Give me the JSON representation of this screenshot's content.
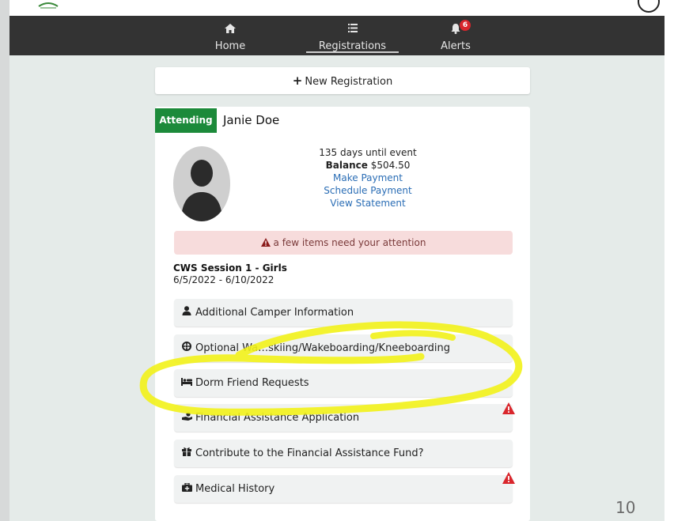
{
  "nav": {
    "items": [
      {
        "label": "Home",
        "icon": "home-icon"
      },
      {
        "label": "Registrations",
        "icon": "list-icon",
        "active": true
      },
      {
        "label": "Alerts",
        "icon": "bell-icon",
        "badge": "6"
      }
    ]
  },
  "new_registration": {
    "label": "New Registration"
  },
  "registration": {
    "status": "Attending",
    "camper_name": "Janie Doe",
    "days_until": "135 days until event",
    "balance_label": "Balance",
    "balance_value": "$504.50",
    "links": [
      "Make Payment",
      "Schedule Payment",
      "View Statement"
    ],
    "attention": "a few items need your attention",
    "session_title": "CWS Session 1 - Girls",
    "session_dates": "6/5/2022 - 6/10/2022"
  },
  "tasks": [
    {
      "label": "Additional Camper Information",
      "icon": "user-icon",
      "warning": false
    },
    {
      "label": "Optional Wa…skiing/Wakeboarding/Kneeboarding",
      "icon": "life-ring-icon",
      "warning": false
    },
    {
      "label": "Dorm Friend Requests",
      "icon": "bed-icon",
      "warning": false
    },
    {
      "label": "Financial Assistance Application",
      "icon": "hand-holding-icon",
      "warning": true
    },
    {
      "label": "Contribute to the Financial Assistance Fund?",
      "icon": "gift-icon",
      "warning": false
    },
    {
      "label": "Medical History",
      "icon": "medkit-icon",
      "warning": true
    }
  ],
  "colors": {
    "navbar": "#333333",
    "attending": "#1c8a3a",
    "link": "#2a6db5",
    "alert_bg": "#f7dcdc",
    "warning": "#d9262c",
    "highlight": "#f2f21a",
    "app_bg": "#e5ebe9"
  },
  "page_number": "10"
}
